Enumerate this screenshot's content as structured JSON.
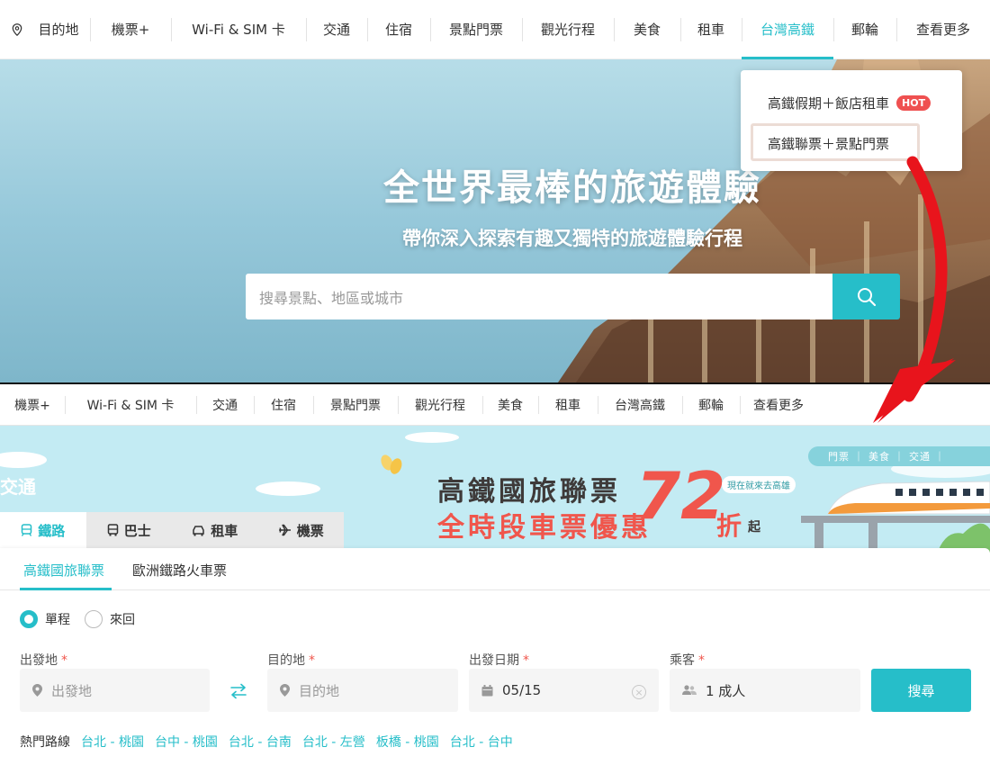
{
  "top": {
    "nav": [
      {
        "label": "目的地",
        "icon": "location-pin-icon"
      },
      {
        "label": "機票+"
      },
      {
        "label": "Wi-Fi & SIM 卡"
      },
      {
        "label": "交通"
      },
      {
        "label": "住宿"
      },
      {
        "label": "景點門票"
      },
      {
        "label": "觀光行程"
      },
      {
        "label": "美食"
      },
      {
        "label": "租車"
      },
      {
        "label": "台灣高鐵",
        "active": true
      },
      {
        "label": "郵輪"
      },
      {
        "label": "查看更多"
      }
    ],
    "dropdown": {
      "items": [
        {
          "label": "高鐵假期＋飯店租車",
          "badge": "HOT"
        },
        {
          "label": "高鐵聯票＋景點門票",
          "highlighted": true
        }
      ]
    },
    "hero": {
      "title": "全世界最棒的旅遊體驗",
      "subtitle": "帶你深入探索有趣又獨特的旅遊體驗行程",
      "search_placeholder": "搜尋景點、地區或城市"
    }
  },
  "bottom": {
    "nav": [
      "機票+",
      "Wi-Fi & SIM 卡",
      "交通",
      "住宿",
      "景點門票",
      "觀光行程",
      "美食",
      "租車",
      "台灣高鐵",
      "郵輪",
      "查看更多"
    ],
    "banner": {
      "section_label": "交通",
      "headline": "高鐵國旅聯票",
      "subheadline": "全時段車票優惠",
      "discount_number": "72",
      "discount_unit": "折",
      "discount_suffix": "起",
      "tag": "現在就來去高雄",
      "top_links": "門票 ｜ 美食 ｜ 交通 ｜"
    },
    "tabs": [
      {
        "label": "鐵路",
        "icon": "train-icon",
        "active": true
      },
      {
        "label": "巴士",
        "icon": "bus-icon"
      },
      {
        "label": "租車",
        "icon": "car-icon"
      },
      {
        "label": "機票",
        "icon": "plane-icon"
      }
    ],
    "subtabs": [
      {
        "label": "高鐵國旅聯票",
        "active": true
      },
      {
        "label": "歐洲鐵路火車票"
      }
    ],
    "trip_type": [
      {
        "label": "單程",
        "selected": true
      },
      {
        "label": "來回",
        "selected": false
      }
    ],
    "form": {
      "origin_label": "出發地",
      "origin_placeholder": "出發地",
      "destination_label": "目的地",
      "destination_placeholder": "目的地",
      "date_label": "出發日期",
      "date_value": "05/15",
      "passenger_label": "乘客",
      "passenger_value": "1 成人",
      "required_mark": "*",
      "search_label": "搜尋"
    },
    "popular": {
      "label": "熱門路線",
      "routes": [
        "台北 - 桃園",
        "台中 - 桃園",
        "台北 - 台南",
        "台北 - 左營",
        "板橋 - 桃園",
        "台北 - 台中"
      ]
    }
  },
  "colors": {
    "accent": "#26bec9",
    "promo_red": "#f0564c",
    "hot_badge": "#ef5050",
    "annotation_arrow": "#e8141c"
  }
}
